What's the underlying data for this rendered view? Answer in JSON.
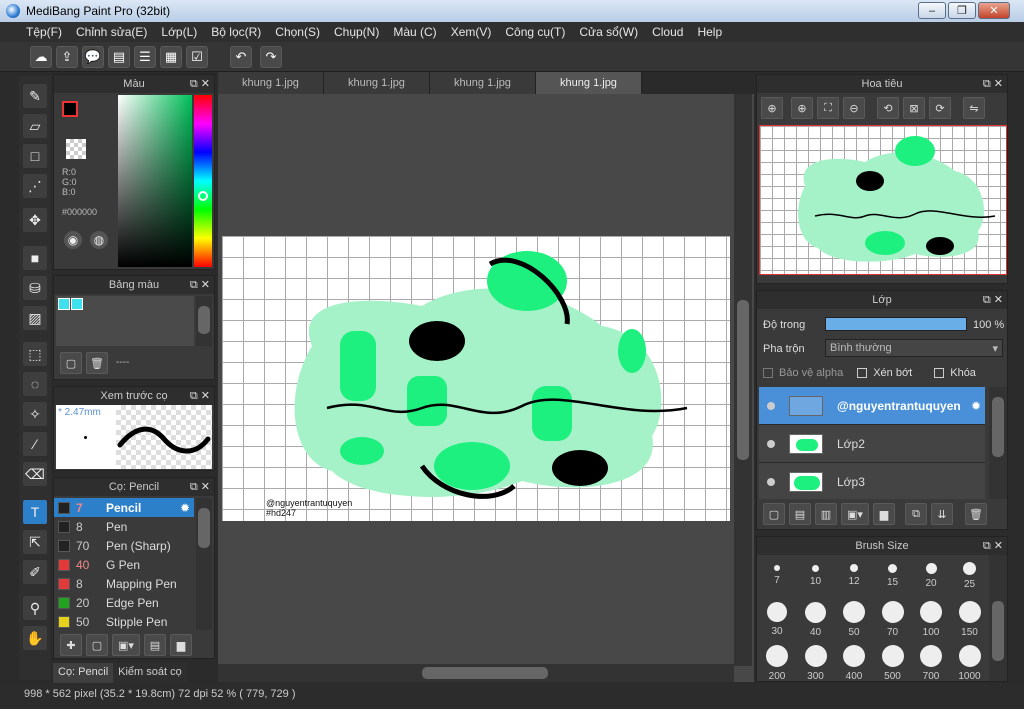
{
  "window": {
    "title": "MediBang Paint Pro (32bit)",
    "minimize": "–",
    "maximize": "❐",
    "close": "✕"
  },
  "menu": [
    "Tệp(F)",
    "Chỉnh sửa(E)",
    "Lớp(L)",
    "Bộ lọc(R)",
    "Chọn(S)",
    "Chụp(N)",
    "Màu (C)",
    "Xem(V)",
    "Công cụ(T)",
    "Cửa sổ(W)",
    "Cloud",
    "Help"
  ],
  "color_panel": {
    "title": "Màu",
    "r": "R:0",
    "g": "G:0",
    "b": "B:0",
    "hex": "#000000",
    "fg": "#000000",
    "bg": "#c085e0"
  },
  "palette_panel": {
    "title": "Bảng màu",
    "status": "----",
    "swatch": "#3de0ec"
  },
  "brush_preview": {
    "title": "Xem trước cọ",
    "size": "2.47mm"
  },
  "brush_panel": {
    "title": "Cọ: Pencil",
    "items": [
      {
        "size": "7",
        "name": "Pencil",
        "color": "#222222"
      },
      {
        "size": "8",
        "name": "Pen",
        "color": "#222222"
      },
      {
        "size": "70",
        "name": "Pen (Sharp)",
        "color": "#222222"
      },
      {
        "size": "40",
        "name": "G Pen",
        "color": "#e23a3a"
      },
      {
        "size": "8",
        "name": "Mapping Pen",
        "color": "#e23a3a"
      },
      {
        "size": "20",
        "name": "Edge Pen",
        "color": "#22a322"
      },
      {
        "size": "50",
        "name": "Stipple Pen",
        "color": "#e6d21a"
      }
    ]
  },
  "bottom_tabs": [
    "Cọ: Pencil",
    "Kiểm soát cọ"
  ],
  "tabs": [
    "khung 1.jpg",
    "khung 1.jpg",
    "khung 1.jpg",
    "khung 1.jpg"
  ],
  "canvas": {
    "watermark1": "@nguyentrantuquyen",
    "watermark2": "#hd247"
  },
  "navigator": {
    "title": "Hoa tiêu"
  },
  "layer_panel": {
    "title": "Lớp",
    "opacity_label": "Độ trong",
    "opacity_value": "100 %",
    "opacity_level": 1.0,
    "blend_label": "Pha trộn",
    "blend_value": "Bình thường",
    "protect_alpha": "Bảo vệ alpha",
    "clipping": "Xén bớt",
    "lock": "Khóa",
    "layers": [
      {
        "name": "@nguyentrantuquyen"
      },
      {
        "name": "Lớp2"
      },
      {
        "name": "Lớp3"
      }
    ]
  },
  "brush_size_panel": {
    "title": "Brush Size",
    "sizes": [
      "7",
      "10",
      "12",
      "15",
      "20",
      "25",
      "30",
      "40",
      "50",
      "70",
      "100",
      "150",
      "200",
      "300",
      "400",
      "500",
      "700",
      "1000"
    ]
  },
  "status": "998 * 562 pixel  (35.2 * 19.8cm)  72 dpi  52 %  ( 779, 729 )"
}
